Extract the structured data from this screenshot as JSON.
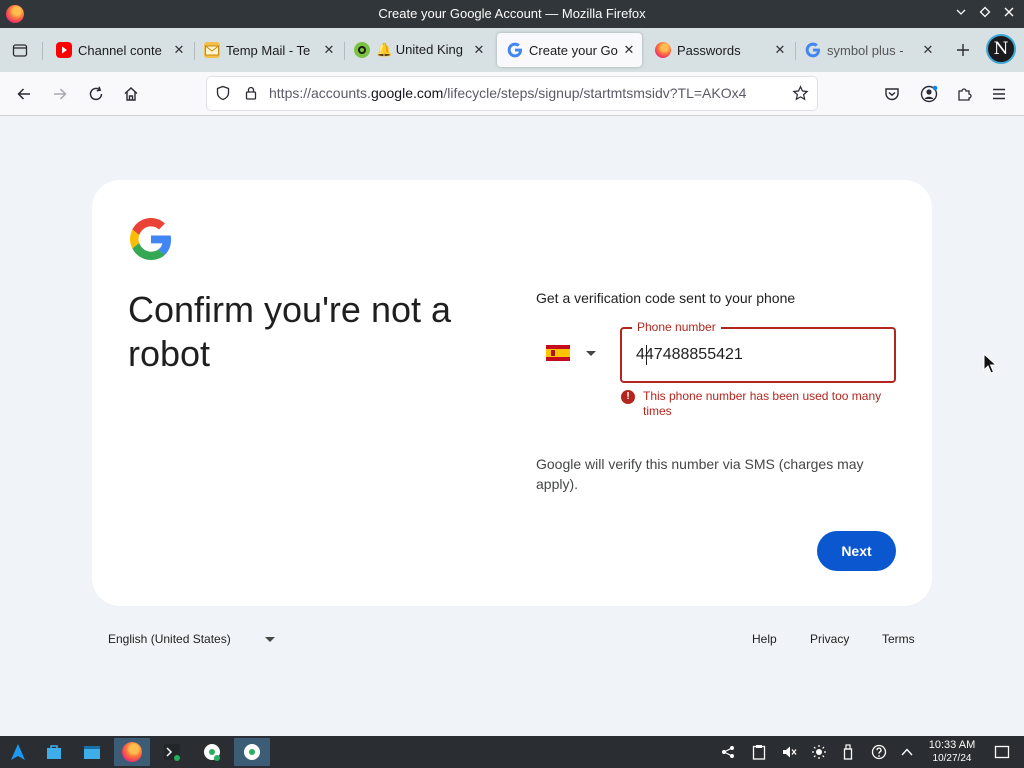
{
  "window": {
    "title": "Create your Google Account — Mozilla Firefox"
  },
  "tabs": [
    {
      "label": "Channel conte",
      "favicon": "youtube-icon",
      "active": false
    },
    {
      "label": "Temp Mail - Te",
      "favicon": "mail-icon",
      "active": false
    },
    {
      "label": "🔔 United King",
      "favicon": "chat-icon",
      "active": false
    },
    {
      "label": "Create your Go",
      "favicon": "google-icon",
      "active": true
    },
    {
      "label": "Passwords",
      "favicon": "firefox-icon",
      "active": false
    },
    {
      "label": "symbol plus - ",
      "favicon": "google-icon",
      "active": false
    }
  ],
  "profile": {
    "initial": "N"
  },
  "urlbar": {
    "prefix": "https://accounts.",
    "domain": "google.com",
    "path": "/lifecycle/steps/signup/startmtsmsidv?TL=AKOx4"
  },
  "page": {
    "heading": "Confirm you're not a robot",
    "prompt": "Get a verification code sent to your phone",
    "country_flag": "spain-flag",
    "phone_label": "Phone number",
    "phone_value": "447488855421",
    "error_text": "This phone number has been used too many times",
    "sms_note": "Google will verify this number via SMS (charges may apply).",
    "next_label": "Next"
  },
  "footer": {
    "language": "English (United States)",
    "help": "Help",
    "privacy": "Privacy",
    "terms": "Terms"
  },
  "taskbar": {
    "time": "10:33 AM",
    "date": "10/27/24"
  },
  "colors": {
    "google_blue": "#0b57d0",
    "error_red": "#b3261e",
    "page_bg": "#f0f4f9"
  }
}
